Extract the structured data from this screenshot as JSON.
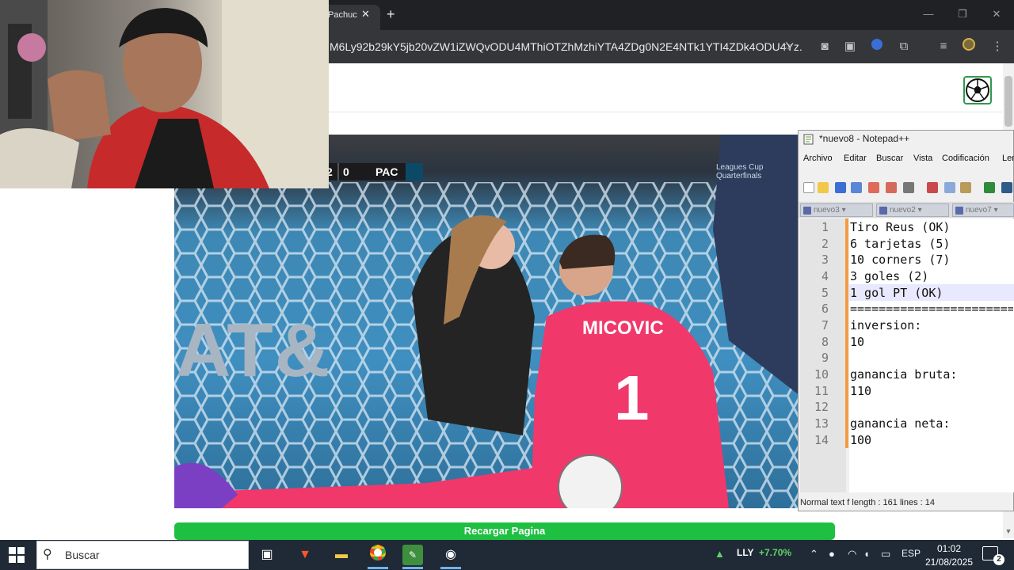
{
  "browser": {
    "tab_title": "Pachuc",
    "tab_close": "✕",
    "new_tab": "+",
    "url": "M6Ly92b29kY5jb20vZW1iZWQvODU4MThiOTZhMzhiYTA4ZDg0N2E4NTk1YTI4ZDk4ODU4Yz...",
    "window_controls": {
      "minimize": "—",
      "restore": "❐",
      "close": "✕"
    }
  },
  "video": {
    "score_home": "2",
    "score_away": "0",
    "team_away": "PAC",
    "competition": [
      "Leagues Cup",
      "Quarterfinals"
    ],
    "sponsor_text": "AT&",
    "player_name": "MICOVIC",
    "player_number": "1"
  },
  "page": {
    "reload_button": "Recargar Pagina"
  },
  "notepad": {
    "title": "*nuevo8 - Notepad++",
    "menu": [
      "Archivo",
      "Editar",
      "Buscar",
      "Vista",
      "Codificación",
      "Len"
    ],
    "tabs": [
      "nuevo3",
      "nuevo2",
      "nuevo7"
    ],
    "lines": [
      {
        "n": "1",
        "text": "Tiro Reus (OK)"
      },
      {
        "n": "2",
        "text": "6 tarjetas (5)"
      },
      {
        "n": "3",
        "text": "10 corners (7)"
      },
      {
        "n": "4",
        "text": "3 goles (2)"
      },
      {
        "n": "5",
        "text": "1 gol PT (OK)"
      },
      {
        "n": "6",
        "text": "=========================="
      },
      {
        "n": "7",
        "text": "inversion:"
      },
      {
        "n": "8",
        "text": "10"
      },
      {
        "n": "9",
        "text": ""
      },
      {
        "n": "10",
        "text": "ganancia bruta:"
      },
      {
        "n": "11",
        "text": "110"
      },
      {
        "n": "12",
        "text": ""
      },
      {
        "n": "13",
        "text": "ganancia neta:"
      },
      {
        "n": "14",
        "text": "100"
      }
    ],
    "status": "Normal text f  length : 161    lines : 14"
  },
  "taskbar": {
    "search_placeholder": "Buscar",
    "stock_symbol": "LLY",
    "stock_change": "+7.70%",
    "language": "ESP",
    "time": "01:02",
    "date": "21/08/2025",
    "notifications": "2"
  },
  "colors": {
    "reload_green": "#1fbf42",
    "notepad_margin": "#f39c3f",
    "keeper_pink": "#f0386b",
    "taskbar": "#1f2a36"
  }
}
